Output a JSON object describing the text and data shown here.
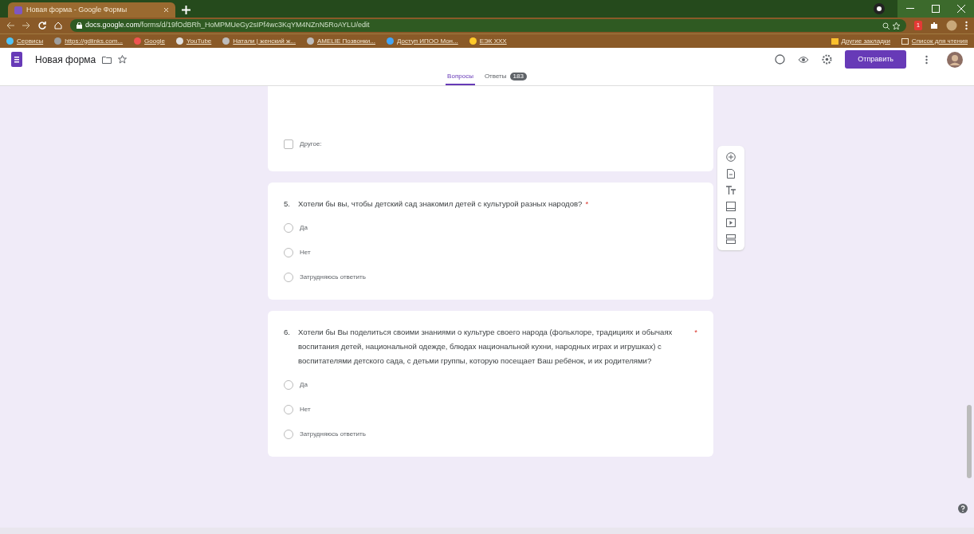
{
  "browser": {
    "tab_title": "Новая форма - Google Формы",
    "url_host": "docs.google.com",
    "url_path": "/forms/d/19fOdBRh_HoMPMUeGy2sIPf4wc3KqYM4NZnN5RoAYLU/edit",
    "notification_count": "1",
    "bookmarks": [
      {
        "label": "Сервисы"
      },
      {
        "label": "https://gdlinks.com..."
      },
      {
        "label": "Google"
      },
      {
        "label": "YouTube"
      },
      {
        "label": "Натали | женский ж..."
      },
      {
        "label": "AMELIE Позвонки..."
      },
      {
        "label": "Доступ ИПОО Мон..."
      },
      {
        "label": "ЕЭК XXX"
      }
    ],
    "other_bookmarks": "Другие закладки",
    "reading_list": "Список для чтения"
  },
  "form": {
    "title": "Новая форма",
    "send_button": "Отправить",
    "tabs": [
      {
        "label": "Вопросы",
        "selected": true
      },
      {
        "label": "Ответы",
        "selected": false,
        "badge": "183"
      }
    ],
    "partial_option": {
      "label": "Другое:",
      "kind": "checkbox",
      "checked": false
    },
    "questions": [
      {
        "number": "5.",
        "text": "Хотели бы вы, чтобы детский сад знакомил детей с культурой разных народов?",
        "required_mark": "*",
        "options": [
          {
            "label": "Да",
            "selected": false
          },
          {
            "label": "Нет",
            "selected": false
          },
          {
            "label": "Затрудняюсь ответить",
            "selected": false
          }
        ]
      },
      {
        "number": "6.",
        "text": "Хотели бы Вы поделиться своими знаниями о культуре своего народа (фольклоре, традициях и обычаях воспитания детей, национальной одежде, блюдах национальной кухни, народных играх и игрушках) с воспитателями детского сада, с детьми группы, которую посещает Ваш ребёнок, и их родителями?",
        "required_mark": "*",
        "options": [
          {
            "label": "Да",
            "selected": false
          },
          {
            "label": "Нет",
            "selected": false
          },
          {
            "label": "Затрудняюсь ответить",
            "selected": false
          }
        ]
      }
    ]
  }
}
